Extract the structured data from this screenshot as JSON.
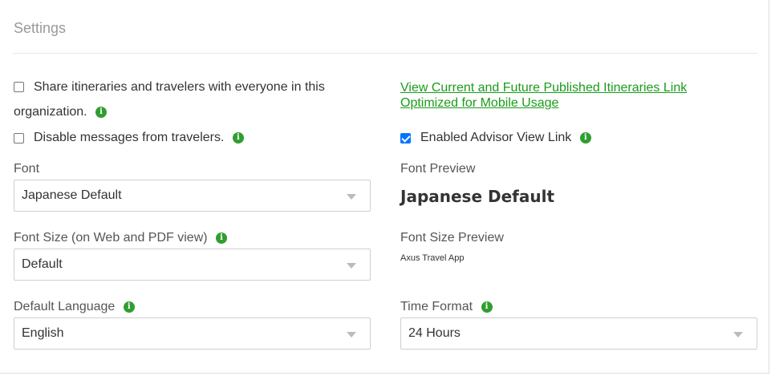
{
  "panel": {
    "title": "Settings"
  },
  "left": {
    "share_label_line1": "Share itineraries and travelers with everyone in this",
    "share_label_line2": "organization.",
    "disable_label": "Disable messages from travelers.",
    "font_label": "Font",
    "font_value": "Japanese Default",
    "font_size_label": "Font Size (on Web and PDF view)",
    "font_size_value": "Default",
    "language_label": "Default Language",
    "language_value": "English"
  },
  "right": {
    "link_line1": "View Current and Future Published Itineraries Link",
    "link_line2": "Optimized for Mobile Usage",
    "advisor_label": "Enabled Advisor View Link",
    "font_preview_label": "Font Preview",
    "font_preview_text": "Japanese Default",
    "font_size_preview_label": "Font Size Preview",
    "font_size_preview_text": "Axus Travel App",
    "time_format_label": "Time Format",
    "time_format_value": "24 Hours"
  },
  "icons": {
    "info": "i"
  },
  "colors": {
    "accent_green": "#2f9e2f",
    "link_green": "#1a9c1a",
    "checkbox_blue": "#0075ff"
  }
}
